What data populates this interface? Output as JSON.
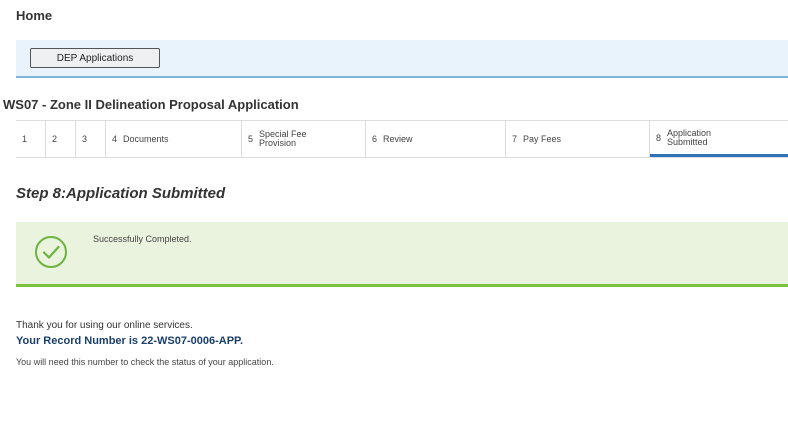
{
  "header": {
    "home_label": "Home"
  },
  "module_bar": {
    "button_label": "DEP Applications"
  },
  "application": {
    "title": "WS07 - Zone II Delineation Proposal Application"
  },
  "steps": [
    {
      "number": "1",
      "label": ""
    },
    {
      "number": "2",
      "label": ""
    },
    {
      "number": "3",
      "label": ""
    },
    {
      "number": "4",
      "label": "Documents"
    },
    {
      "number": "5",
      "label": "Special Fee Provision"
    },
    {
      "number": "6",
      "label": "Review"
    },
    {
      "number": "7",
      "label": "Pay Fees"
    },
    {
      "number": "8",
      "label": "Application Submitted"
    }
  ],
  "active_step": 8,
  "step_heading": "Step 8:Application Submitted",
  "success": {
    "message": "Successfully Completed.",
    "icon": "check-circle-icon"
  },
  "confirmation": {
    "thanks": "Thank you for using our online services.",
    "record_line": "Your Record Number is 22-WS07-0006-APP.",
    "note": "You will need this number to check the status of your application."
  },
  "colors": {
    "module_bar_bg": "#e8f3fb",
    "active_step_underline": "#2e73b8",
    "success_bg": "#eaf3de",
    "success_accent": "#7dc143",
    "record_text": "#1a3f6c"
  }
}
